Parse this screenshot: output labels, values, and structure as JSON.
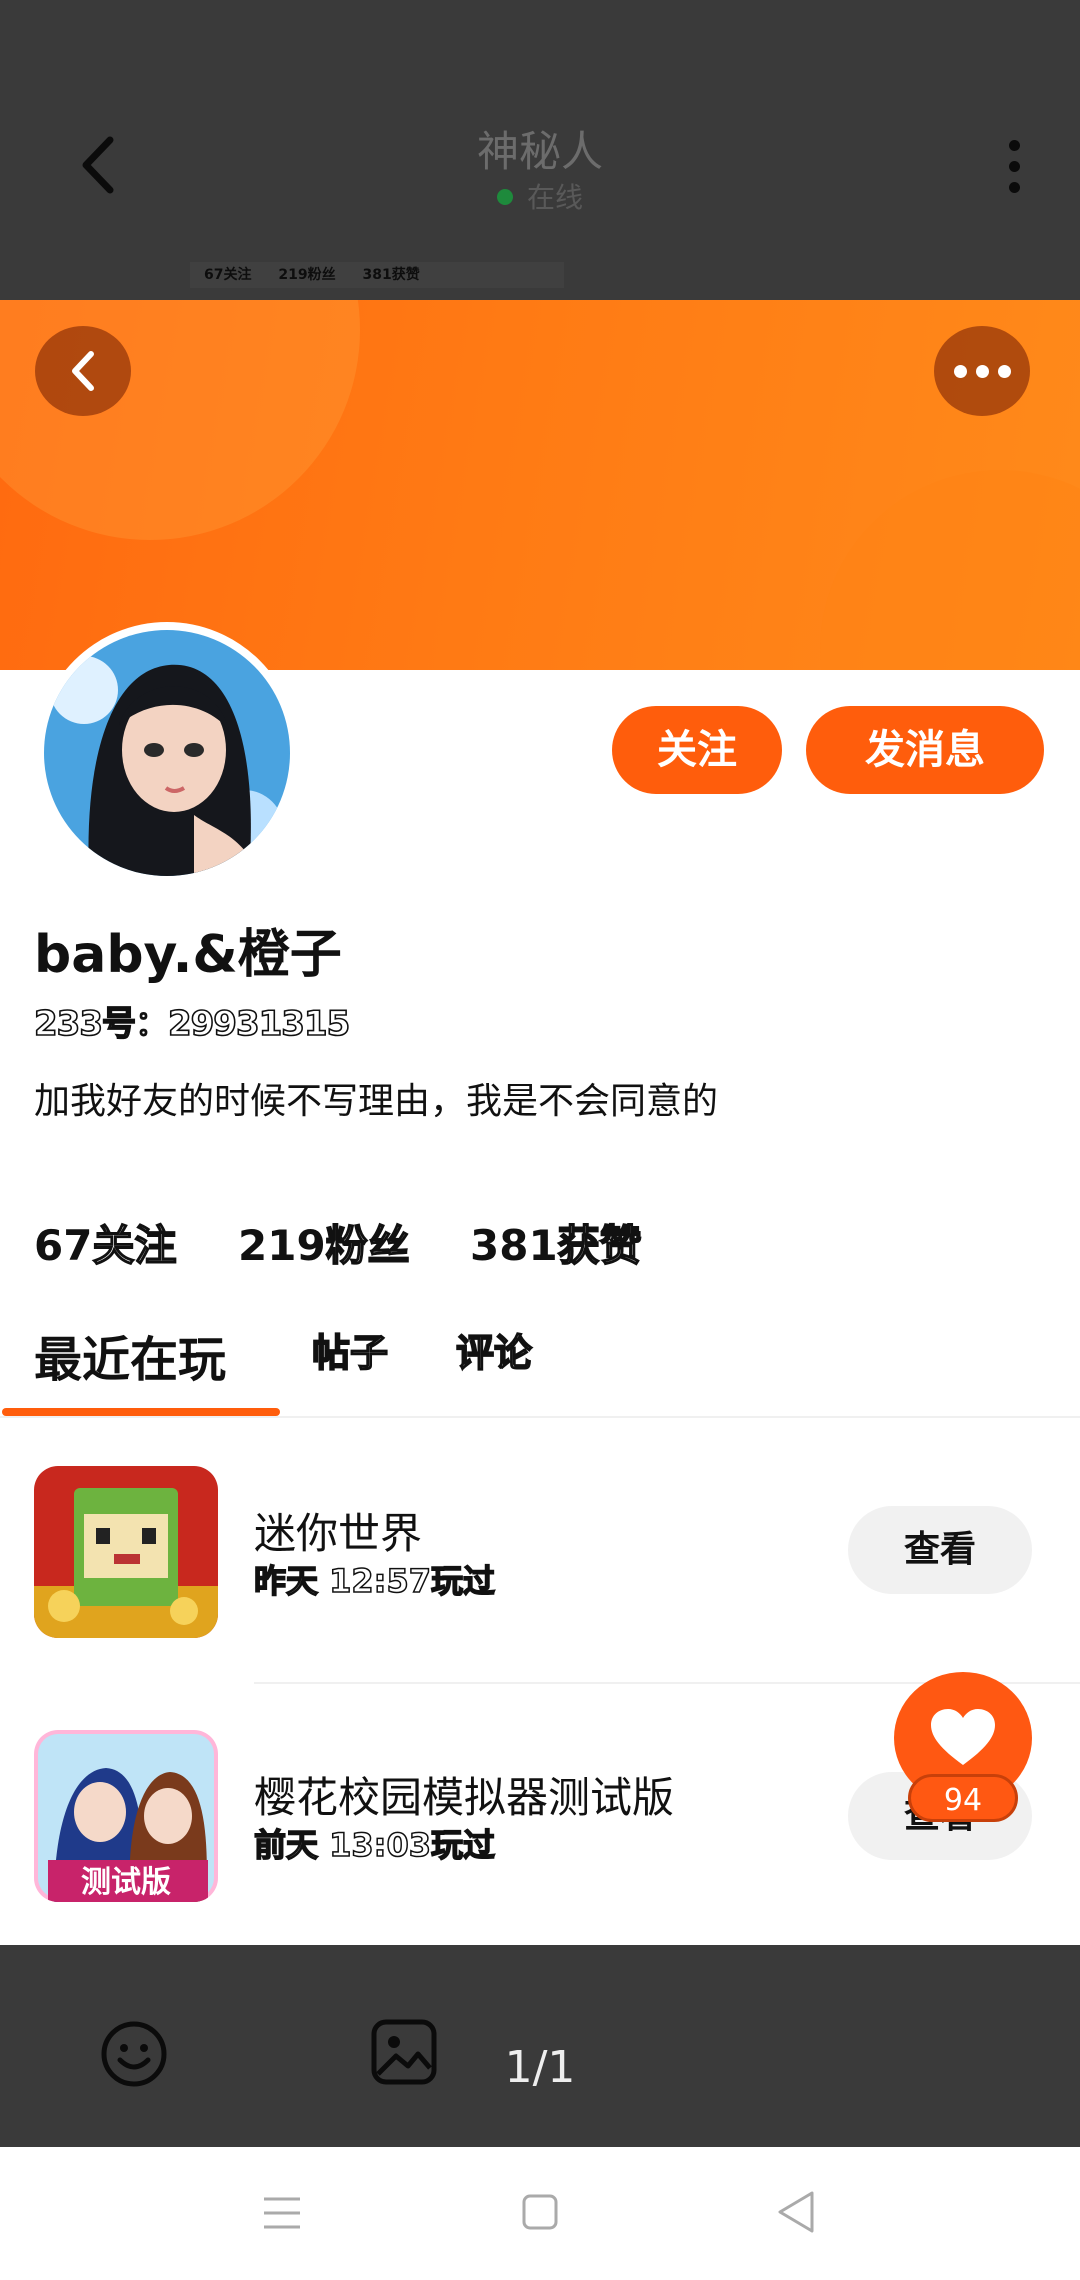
{
  "top_bar": {
    "title": "神秘人",
    "status": "在线",
    "stats": [
      "67关注",
      "219粉丝",
      "381获赞"
    ]
  },
  "profile": {
    "follow_label": "关注",
    "message_label": "发消息",
    "username": "baby.&橙子",
    "user_id": "233号：29931315",
    "bio": "加我好友的时候不写理由，我是不会同意的",
    "stats": {
      "following": "67",
      "following_label": "关注",
      "fans": "219",
      "fans_label": "粉丝",
      "likes": "381",
      "likes_label": "获赞"
    }
  },
  "tabs": [
    {
      "label": "最近在玩"
    },
    {
      "label": "帖子"
    },
    {
      "label": "评论"
    }
  ],
  "games": [
    {
      "name": "迷你世界",
      "time": "昨天 12:57玩过",
      "action": "查看"
    },
    {
      "name": "樱花校园模拟器测试版",
      "time": "前天 13:03玩过",
      "action": "查看",
      "badge": "测试版"
    }
  ],
  "like_count": "94",
  "page_indicator": "1/1",
  "colors": {
    "accent": "#ff5d0c",
    "overlay": "#3a3a3a"
  }
}
